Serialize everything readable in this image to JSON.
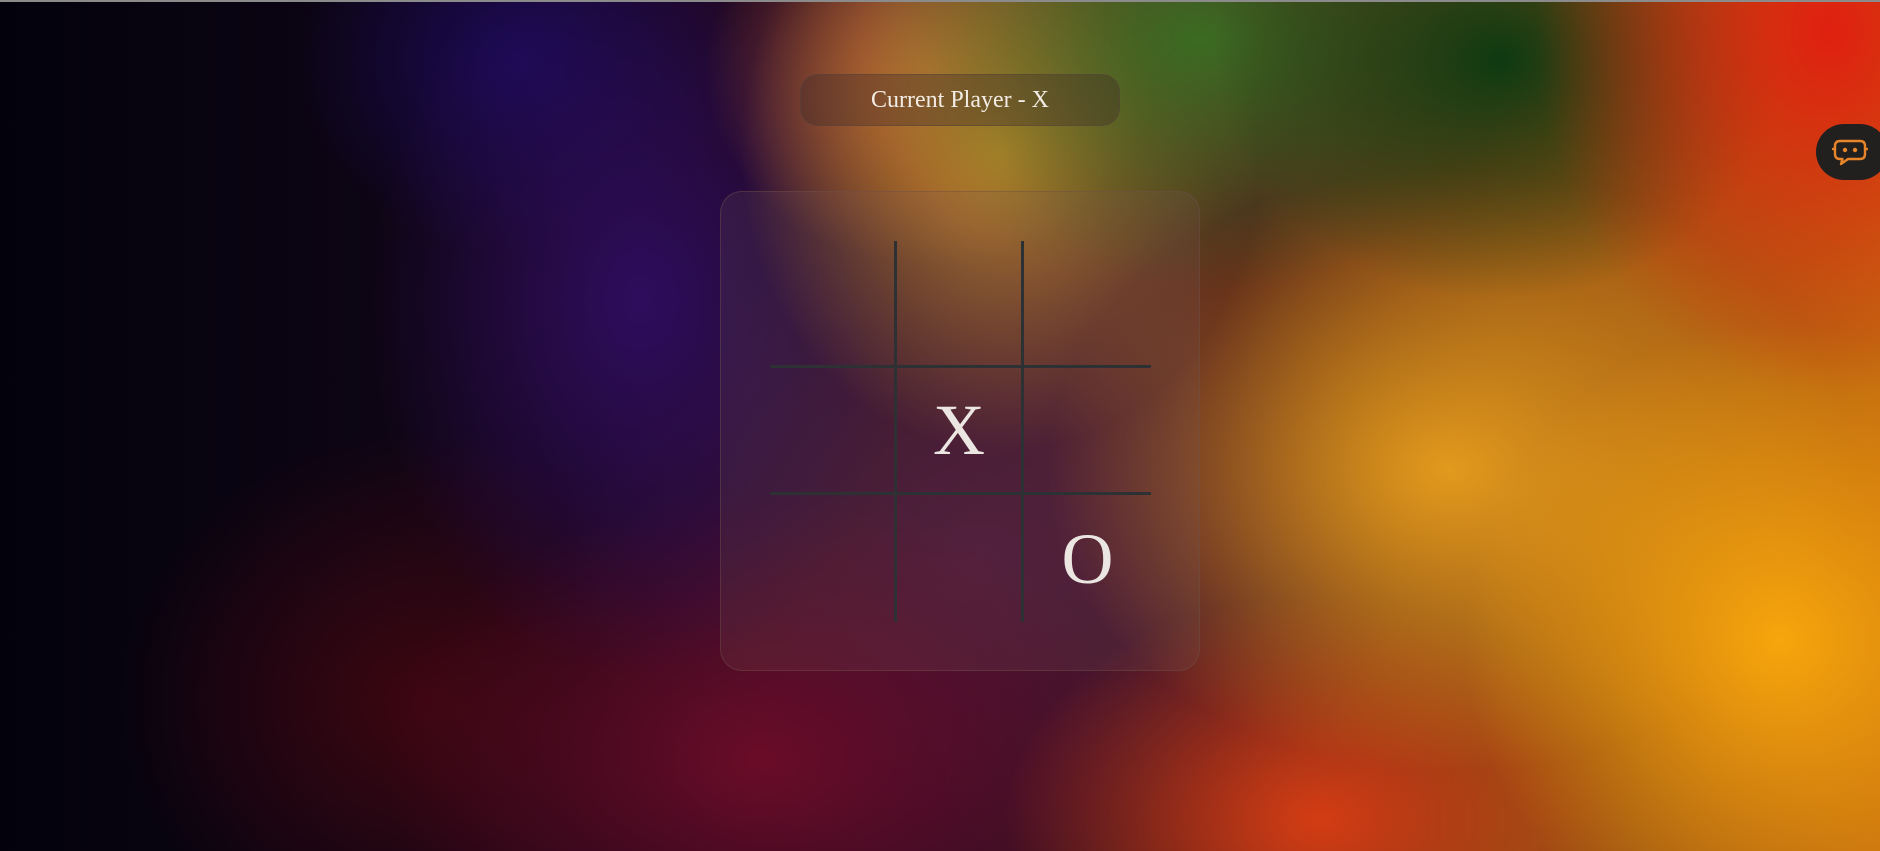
{
  "status": {
    "text": "Current Player - X"
  },
  "board": {
    "cells": [
      "",
      "",
      "",
      "",
      "X",
      "",
      "",
      "",
      "O"
    ]
  },
  "assistant": {
    "icon": "chatbot-icon",
    "accent": "#e8842a"
  }
}
